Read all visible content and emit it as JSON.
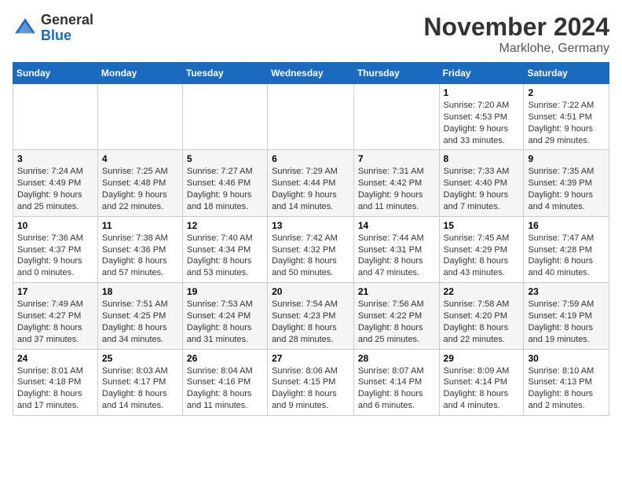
{
  "header": {
    "logo_general": "General",
    "logo_blue": "Blue",
    "month_title": "November 2024",
    "location": "Marklohe, Germany"
  },
  "days_of_week": [
    "Sunday",
    "Monday",
    "Tuesday",
    "Wednesday",
    "Thursday",
    "Friday",
    "Saturday"
  ],
  "weeks": [
    [
      null,
      null,
      null,
      null,
      null,
      {
        "day": 1,
        "sunrise": "7:20 AM",
        "sunset": "4:53 PM",
        "daylight": "9 hours and 33 minutes."
      },
      {
        "day": 2,
        "sunrise": "7:22 AM",
        "sunset": "4:51 PM",
        "daylight": "9 hours and 29 minutes."
      }
    ],
    [
      {
        "day": 3,
        "sunrise": "7:24 AM",
        "sunset": "4:49 PM",
        "daylight": "9 hours and 25 minutes."
      },
      {
        "day": 4,
        "sunrise": "7:25 AM",
        "sunset": "4:48 PM",
        "daylight": "9 hours and 22 minutes."
      },
      {
        "day": 5,
        "sunrise": "7:27 AM",
        "sunset": "4:46 PM",
        "daylight": "9 hours and 18 minutes."
      },
      {
        "day": 6,
        "sunrise": "7:29 AM",
        "sunset": "4:44 PM",
        "daylight": "9 hours and 14 minutes."
      },
      {
        "day": 7,
        "sunrise": "7:31 AM",
        "sunset": "4:42 PM",
        "daylight": "9 hours and 11 minutes."
      },
      {
        "day": 8,
        "sunrise": "7:33 AM",
        "sunset": "4:40 PM",
        "daylight": "9 hours and 7 minutes."
      },
      {
        "day": 9,
        "sunrise": "7:35 AM",
        "sunset": "4:39 PM",
        "daylight": "9 hours and 4 minutes."
      }
    ],
    [
      {
        "day": 10,
        "sunrise": "7:36 AM",
        "sunset": "4:37 PM",
        "daylight": "9 hours and 0 minutes."
      },
      {
        "day": 11,
        "sunrise": "7:38 AM",
        "sunset": "4:36 PM",
        "daylight": "8 hours and 57 minutes."
      },
      {
        "day": 12,
        "sunrise": "7:40 AM",
        "sunset": "4:34 PM",
        "daylight": "8 hours and 53 minutes."
      },
      {
        "day": 13,
        "sunrise": "7:42 AM",
        "sunset": "4:32 PM",
        "daylight": "8 hours and 50 minutes."
      },
      {
        "day": 14,
        "sunrise": "7:44 AM",
        "sunset": "4:31 PM",
        "daylight": "8 hours and 47 minutes."
      },
      {
        "day": 15,
        "sunrise": "7:45 AM",
        "sunset": "4:29 PM",
        "daylight": "8 hours and 43 minutes."
      },
      {
        "day": 16,
        "sunrise": "7:47 AM",
        "sunset": "4:28 PM",
        "daylight": "8 hours and 40 minutes."
      }
    ],
    [
      {
        "day": 17,
        "sunrise": "7:49 AM",
        "sunset": "4:27 PM",
        "daylight": "8 hours and 37 minutes."
      },
      {
        "day": 18,
        "sunrise": "7:51 AM",
        "sunset": "4:25 PM",
        "daylight": "8 hours and 34 minutes."
      },
      {
        "day": 19,
        "sunrise": "7:53 AM",
        "sunset": "4:24 PM",
        "daylight": "8 hours and 31 minutes."
      },
      {
        "day": 20,
        "sunrise": "7:54 AM",
        "sunset": "4:23 PM",
        "daylight": "8 hours and 28 minutes."
      },
      {
        "day": 21,
        "sunrise": "7:56 AM",
        "sunset": "4:22 PM",
        "daylight": "8 hours and 25 minutes."
      },
      {
        "day": 22,
        "sunrise": "7:58 AM",
        "sunset": "4:20 PM",
        "daylight": "8 hours and 22 minutes."
      },
      {
        "day": 23,
        "sunrise": "7:59 AM",
        "sunset": "4:19 PM",
        "daylight": "8 hours and 19 minutes."
      }
    ],
    [
      {
        "day": 24,
        "sunrise": "8:01 AM",
        "sunset": "4:18 PM",
        "daylight": "8 hours and 17 minutes."
      },
      {
        "day": 25,
        "sunrise": "8:03 AM",
        "sunset": "4:17 PM",
        "daylight": "8 hours and 14 minutes."
      },
      {
        "day": 26,
        "sunrise": "8:04 AM",
        "sunset": "4:16 PM",
        "daylight": "8 hours and 11 minutes."
      },
      {
        "day": 27,
        "sunrise": "8:06 AM",
        "sunset": "4:15 PM",
        "daylight": "8 hours and 9 minutes."
      },
      {
        "day": 28,
        "sunrise": "8:07 AM",
        "sunset": "4:14 PM",
        "daylight": "8 hours and 6 minutes."
      },
      {
        "day": 29,
        "sunrise": "8:09 AM",
        "sunset": "4:14 PM",
        "daylight": "8 hours and 4 minutes."
      },
      {
        "day": 30,
        "sunrise": "8:10 AM",
        "sunset": "4:13 PM",
        "daylight": "8 hours and 2 minutes."
      }
    ]
  ]
}
